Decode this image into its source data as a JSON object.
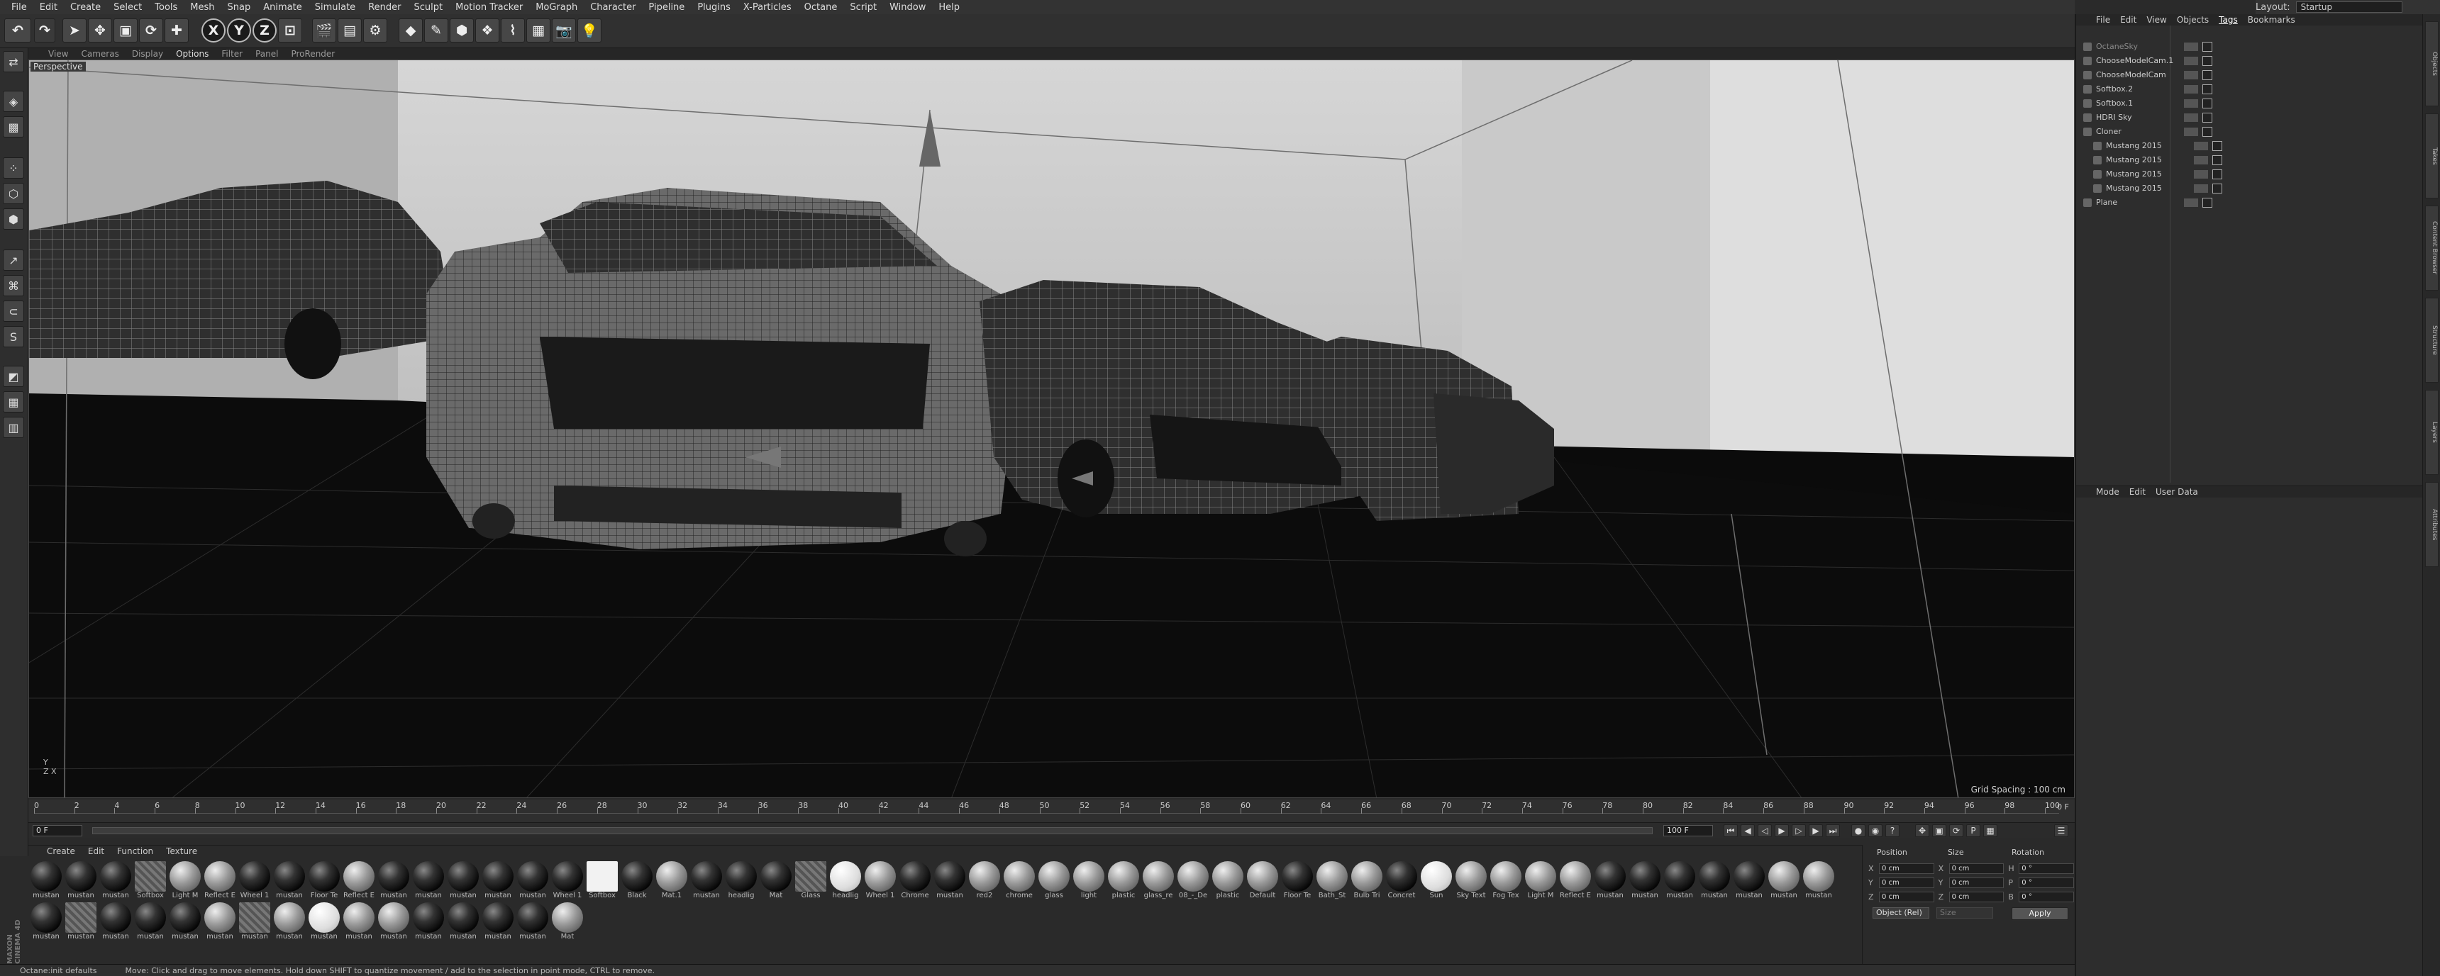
{
  "menubar": [
    "File",
    "Edit",
    "Create",
    "Select",
    "Tools",
    "Mesh",
    "Snap",
    "Animate",
    "Simulate",
    "Render",
    "Sculpt",
    "Motion Tracker",
    "MoGraph",
    "Character",
    "Pipeline",
    "Plugins",
    "X-Particles",
    "Octane",
    "Script",
    "Window",
    "Help"
  ],
  "layout": {
    "label": "Layout:",
    "value": "Startup"
  },
  "toolbar": {
    "x_axis": "X",
    "y_axis": "Y",
    "z_axis": "Z"
  },
  "viewport": {
    "menu": [
      "View",
      "Cameras",
      "Display",
      "Options",
      "Filter",
      "Panel",
      "ProRender"
    ],
    "active_menu": "Options",
    "label": "Perspective",
    "grid_spacing": "Grid Spacing : 100 cm",
    "axis_y": "Y",
    "axis_z": "Z",
    "axis_x": "X"
  },
  "timeline": {
    "ticks": [
      "0",
      "2",
      "4",
      "6",
      "8",
      "10",
      "12",
      "14",
      "16",
      "18",
      "20",
      "22",
      "24",
      "26",
      "28",
      "30",
      "32",
      "34",
      "36",
      "38",
      "40",
      "42",
      "44",
      "46",
      "48",
      "50",
      "52",
      "54",
      "56",
      "58",
      "60",
      "62",
      "64",
      "66",
      "68",
      "70",
      "72",
      "74",
      "76",
      "78",
      "80",
      "82",
      "84",
      "86",
      "88",
      "90",
      "92",
      "94",
      "96",
      "98",
      "100"
    ],
    "end_frame_label": "0 F",
    "start_field": "0 F",
    "end_field": "100 F"
  },
  "material_manager": {
    "menu": [
      "Create",
      "Edit",
      "Function",
      "Texture"
    ],
    "materials": [
      {
        "name": "mustan",
        "look": "dark"
      },
      {
        "name": "mustan",
        "look": "dark"
      },
      {
        "name": "mustan",
        "look": "dark"
      },
      {
        "name": "Softbox",
        "look": "sq"
      },
      {
        "name": "Light M",
        "look": "light"
      },
      {
        "name": "Reflect E",
        "look": "light"
      },
      {
        "name": "Wheel 1",
        "look": "dark"
      },
      {
        "name": "mustan",
        "look": "dark"
      },
      {
        "name": "Floor Te",
        "look": "dark"
      },
      {
        "name": "Reflect E",
        "look": "light"
      },
      {
        "name": "mustan",
        "look": "dark"
      },
      {
        "name": "mustan",
        "look": "dark"
      },
      {
        "name": "mustan",
        "look": "dark"
      },
      {
        "name": "mustan",
        "look": "dark"
      },
      {
        "name": "mustan",
        "look": "dark"
      },
      {
        "name": "Wheel 1",
        "look": "dark"
      },
      {
        "name": "Softbox",
        "look": "wsq"
      },
      {
        "name": "Black",
        "look": "dark"
      },
      {
        "name": "Mat.1",
        "look": "light"
      },
      {
        "name": "mustan",
        "look": "dark"
      },
      {
        "name": "headlig",
        "look": "dark"
      },
      {
        "name": "Mat",
        "look": "dark"
      },
      {
        "name": "Glass",
        "look": "sq"
      },
      {
        "name": "headlig",
        "look": "white"
      },
      {
        "name": "Wheel 1",
        "look": "light"
      },
      {
        "name": "Chrome",
        "look": "dark"
      },
      {
        "name": "mustan",
        "look": "dark"
      },
      {
        "name": "red2",
        "look": "light"
      },
      {
        "name": "chrome",
        "look": "light"
      },
      {
        "name": "glass",
        "look": "light"
      },
      {
        "name": "light",
        "look": "light"
      },
      {
        "name": "plastic",
        "look": "light"
      },
      {
        "name": "glass_re",
        "look": "light"
      },
      {
        "name": "08_-_De",
        "look": "light"
      },
      {
        "name": "plastic",
        "look": "light"
      },
      {
        "name": "Default",
        "look": "light"
      },
      {
        "name": "Floor Te",
        "look": "dark"
      },
      {
        "name": "Bath_St",
        "look": "light"
      },
      {
        "name": "Bulb Tri",
        "look": "light"
      },
      {
        "name": "Concret",
        "look": "dark"
      },
      {
        "name": "Sun",
        "look": "white"
      },
      {
        "name": "Sky Text",
        "look": "light"
      },
      {
        "name": "Fog Tex",
        "look": "light"
      },
      {
        "name": "Light M",
        "look": "light"
      },
      {
        "name": "Reflect E",
        "look": "light"
      },
      {
        "name": "mustan",
        "look": "dark"
      },
      {
        "name": "mustan",
        "look": "dark"
      },
      {
        "name": "mustan",
        "look": "dark"
      },
      {
        "name": "mustan",
        "look": "dark"
      },
      {
        "name": "mustan",
        "look": "dark"
      },
      {
        "name": "mustan",
        "look": "light"
      },
      {
        "name": "mustan",
        "look": "light"
      },
      {
        "name": "mustan",
        "look": "dark"
      },
      {
        "name": "mustan",
        "look": "sq"
      },
      {
        "name": "mustan",
        "look": "dark"
      },
      {
        "name": "mustan",
        "look": "dark"
      },
      {
        "name": "mustan",
        "look": "dark"
      },
      {
        "name": "mustan",
        "look": "light"
      },
      {
        "name": "mustan",
        "look": "sq"
      },
      {
        "name": "mustan",
        "look": "light"
      },
      {
        "name": "mustan",
        "look": "white"
      },
      {
        "name": "mustan",
        "look": "light"
      },
      {
        "name": "mustan",
        "look": "light"
      },
      {
        "name": "mustan",
        "look": "dark"
      },
      {
        "name": "mustan",
        "look": "dark"
      },
      {
        "name": "mustan",
        "look": "dark"
      },
      {
        "name": "mustan",
        "look": "dark"
      },
      {
        "name": "Mat",
        "look": "light"
      }
    ]
  },
  "coordinates": {
    "headers": [
      "Position",
      "Size",
      "Rotation"
    ],
    "rows": [
      {
        "a": "X",
        "p": "0 cm",
        "s": "0 cm",
        "r_axis": "H",
        "r": "0 °"
      },
      {
        "a": "Y",
        "p": "0 cm",
        "s": "0 cm",
        "r_axis": "P",
        "r": "0 °"
      },
      {
        "a": "Z",
        "p": "0 cm",
        "s": "0 cm",
        "r_axis": "B",
        "r": "0 °"
      }
    ],
    "mode": "Object (Rel)",
    "size_mode": "Size",
    "apply": "Apply"
  },
  "status": {
    "left": "Octane:init defaults",
    "message": "Move: Click and drag to move elements. Hold down SHIFT to quantize movement / add to the selection in point mode, CTRL to remove."
  },
  "maxon": "MAXON CINEMA 4D",
  "object_manager": {
    "menu": [
      "File",
      "Edit",
      "View",
      "Objects",
      "Tags",
      "Bookmarks"
    ],
    "active": "Tags",
    "objects": [
      {
        "name": "OctaneSky",
        "indent": 0,
        "dim": true
      },
      {
        "name": "ChooseModelCam.1",
        "indent": 0
      },
      {
        "name": "ChooseModelCam",
        "indent": 0
      },
      {
        "name": "Softbox.2",
        "indent": 0
      },
      {
        "name": "Softbox.1",
        "indent": 0
      },
      {
        "name": "HDRI Sky",
        "indent": 0
      },
      {
        "name": "Cloner",
        "indent": 0
      },
      {
        "name": "Mustang 2015",
        "indent": 1
      },
      {
        "name": "Mustang 2015",
        "indent": 1
      },
      {
        "name": "Mustang 2015",
        "indent": 1
      },
      {
        "name": "Mustang 2015",
        "indent": 1
      },
      {
        "name": "Plane",
        "indent": 0
      }
    ]
  },
  "attribute_manager": {
    "menu": [
      "Mode",
      "Edit",
      "User Data"
    ]
  },
  "side_tabs": [
    "Objects",
    "Takes",
    "Content Browser",
    "Structure",
    "Layers",
    "Attributes"
  ]
}
